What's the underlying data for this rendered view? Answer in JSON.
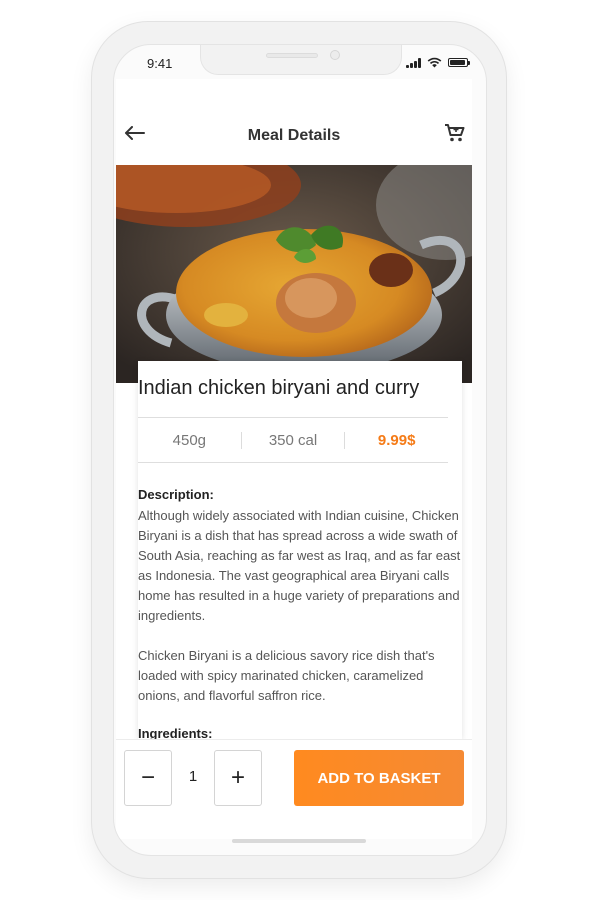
{
  "status_bar": {
    "time": "9:41"
  },
  "header": {
    "title": "Meal Details"
  },
  "meal": {
    "name": "Indian chicken biryani and curry",
    "weight": "450g",
    "calories": "350 cal",
    "price": "9.99$"
  },
  "description": {
    "label": "Description:",
    "paragraphs": [
      "Although widely associated with Indian cuisine, Chicken Biryani is a dish that has spread across a wide swath of South Asia, reaching as far west as Iraq, and as far east as Indonesia. The vast geographical area Biryani calls home has resulted in a huge variety of preparations and ingredients.",
      "Chicken Biryani is a delicious savory rice dish that's loaded with spicy marinated chicken, caramelized onions, and flavorful saffron rice."
    ]
  },
  "ingredients": {
    "label": "Ingredients:"
  },
  "footer": {
    "minus": "−",
    "quantity": "1",
    "plus": "+",
    "add_to_basket": "ADD TO BASKET"
  },
  "colors": {
    "accent": "#f57b17"
  },
  "icons": {
    "back": "arrow-left-icon",
    "cart": "shopping-cart-icon"
  }
}
